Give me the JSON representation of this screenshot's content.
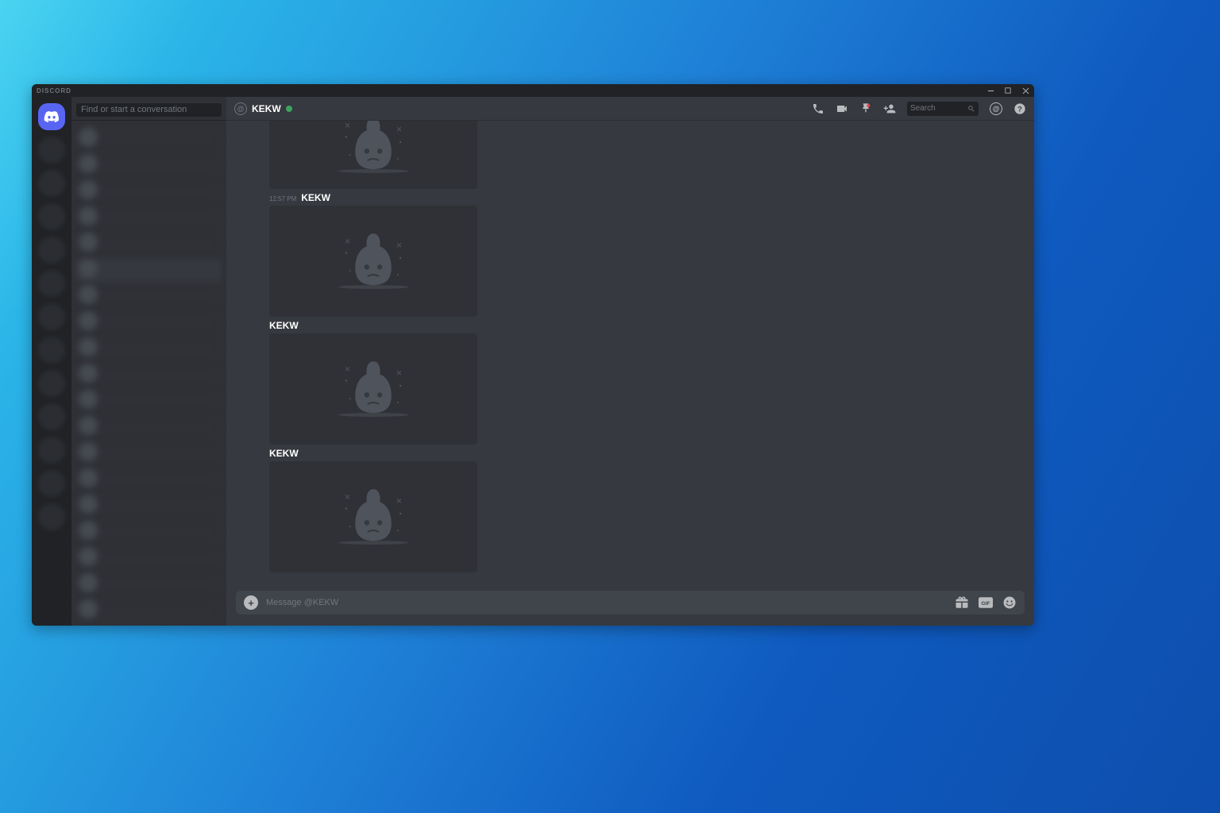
{
  "titlebar": {
    "label": "DISCORD"
  },
  "sidebar": {
    "search_placeholder": "Find or start a conversation"
  },
  "header": {
    "name": "KEKW",
    "search_placeholder": "Search"
  },
  "messages": [
    {
      "time": "",
      "author": "",
      "has_image": true,
      "short": true
    },
    {
      "time": "12:57 PM",
      "author": "KEKW",
      "has_image": true,
      "short": false
    },
    {
      "time": "",
      "author": "KEKW",
      "has_image": true,
      "short": false
    },
    {
      "time": "",
      "author": "KEKW",
      "has_image": true,
      "short": false
    }
  ],
  "composer": {
    "placeholder": "Message @KEKW"
  }
}
